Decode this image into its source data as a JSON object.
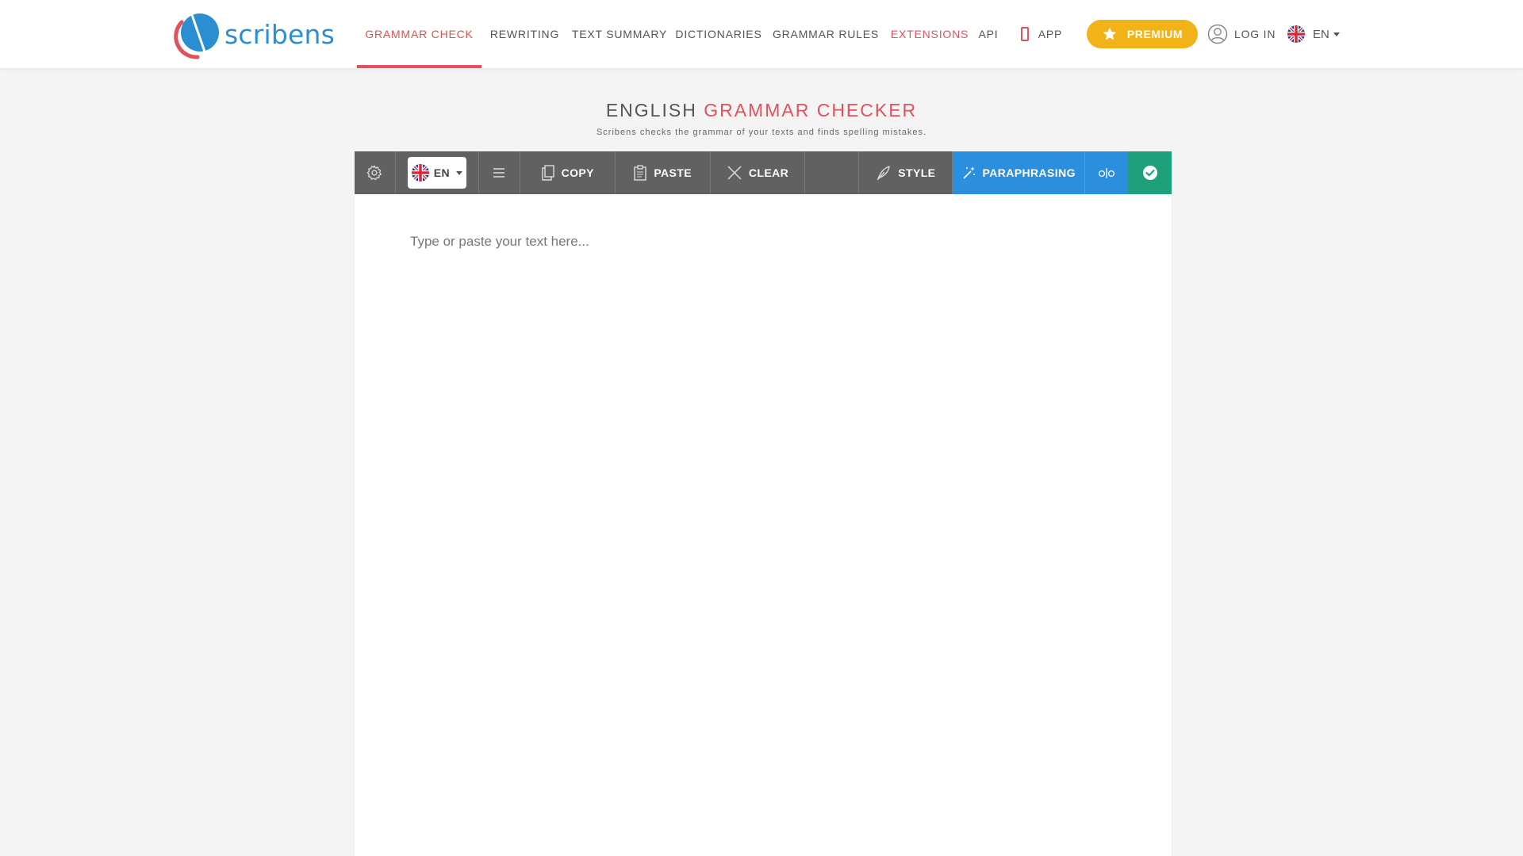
{
  "brand": {
    "name": "scribens",
    "color": "#2a8fd1",
    "accent": "#e0525d"
  },
  "nav": {
    "items": [
      {
        "label": "GRAMMAR CHECK",
        "active": true
      },
      {
        "label": "REWRITING"
      },
      {
        "label": "TEXT SUMMARY"
      },
      {
        "label": "DICTIONARIES"
      },
      {
        "label": "GRAMMAR RULES"
      },
      {
        "label": "EXTENSIONS",
        "highlight": true
      },
      {
        "label": "API"
      },
      {
        "label": "APP",
        "icon": "phone-icon"
      }
    ],
    "premium_label": "PREMIUM",
    "premium_icon": "star-icon",
    "premium_color": "#f2b319",
    "login_label": "LOG IN",
    "login_icon": "user-circle-icon",
    "lang_label": "EN",
    "lang_flag": "uk-flag-icon"
  },
  "page": {
    "title_prefix": "ENGLISH",
    "title_accent": "GRAMMAR CHECKER",
    "subtitle": "Scribens checks the grammar of your texts and finds spelling mistakes."
  },
  "toolbar": {
    "settings_icon": "gear-icon",
    "lang_label": "EN",
    "menu_icon": "list-icon",
    "copy_label": "COPY",
    "paste_label": "PASTE",
    "clear_label": "CLEAR",
    "style_label": "STYLE",
    "paraphrasing_label": "PARAPHRASING",
    "compare_icon": "compare-icon",
    "check_icon": "check-circle-icon",
    "colors": {
      "bar": "#616161",
      "paraphrasing": "#2c8fde",
      "check": "#1ea07a"
    }
  },
  "editor": {
    "placeholder": "Type or paste your text here...",
    "value": ""
  }
}
